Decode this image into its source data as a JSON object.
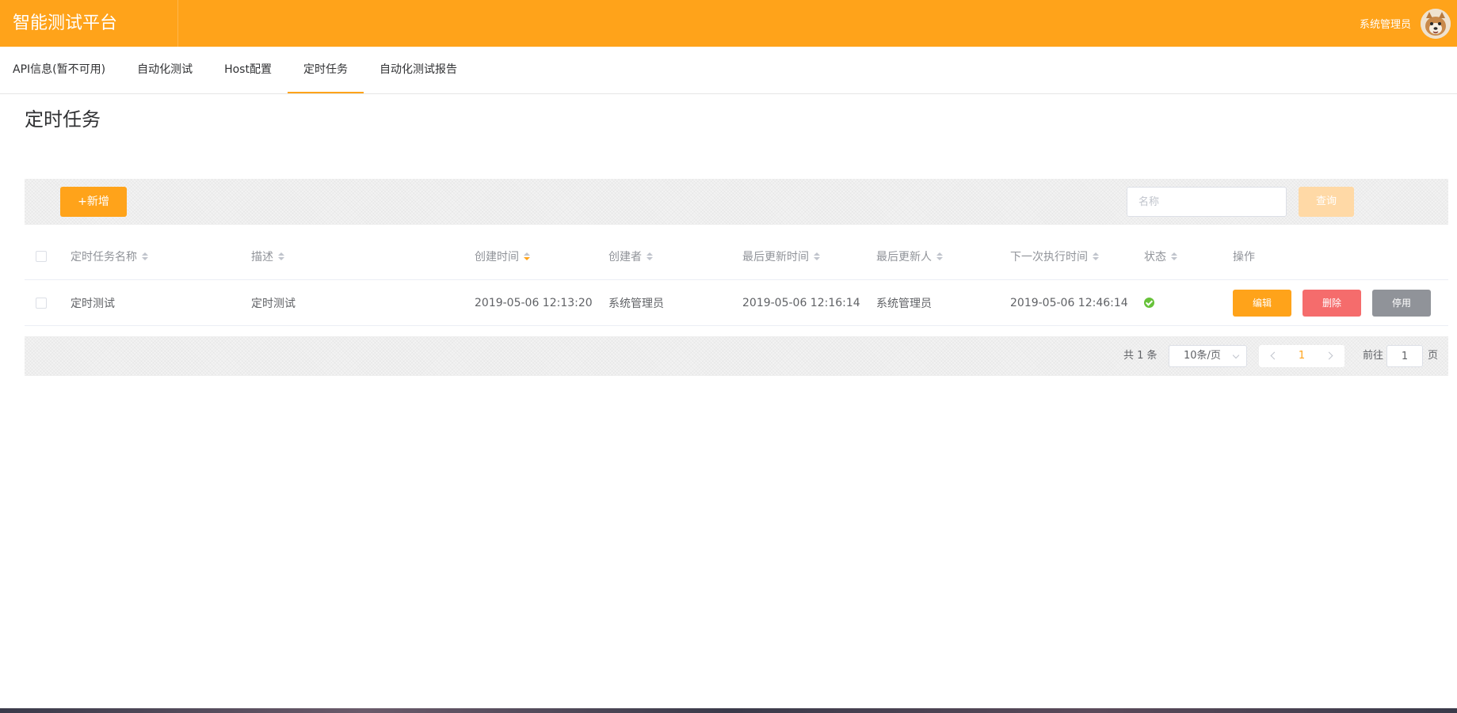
{
  "app": {
    "title": "智能测试平台",
    "user_name": "系统管理员"
  },
  "nav": {
    "items": [
      {
        "label": "API信息(暂不可用)",
        "active": false
      },
      {
        "label": "自动化测试",
        "active": false
      },
      {
        "label": "Host配置",
        "active": false
      },
      {
        "label": "定时任务",
        "active": true
      },
      {
        "label": "自动化测试报告",
        "active": false
      }
    ]
  },
  "page": {
    "title": "定时任务"
  },
  "toolbar": {
    "add_label": "+新增",
    "search_placeholder": "名称",
    "query_label": "查询"
  },
  "table": {
    "headers": [
      "定时任务名称",
      "描述",
      "创建时间",
      "创建者",
      "最后更新时间",
      "最后更新人",
      "下一次执行时间",
      "状态",
      "操作"
    ],
    "rows": [
      {
        "name": "定时测试",
        "description": "定时测试",
        "created_at": "2019-05-06 12:13:20",
        "creator": "系统管理员",
        "updated_at": "2019-05-06 12:16:14",
        "updater": "系统管理员",
        "next_run": "2019-05-06 12:46:14",
        "status": "enabled",
        "actions": {
          "edit": "编辑",
          "delete": "删除",
          "disable": "停用"
        }
      }
    ]
  },
  "pagination": {
    "total_text": "共 1 条",
    "page_size": "10条/页",
    "current_page": "1",
    "goto_label": "前往",
    "goto_value": "1",
    "page_suffix": "页"
  },
  "colors": {
    "accent": "#ffa31a",
    "danger": "#f56c6c",
    "neutral": "#909399",
    "success": "#67c23a"
  },
  "icons": {
    "status": "check-circle-icon",
    "sort": "sort-caret-icon",
    "prev": "chevron-left-icon",
    "next": "chevron-right-icon",
    "select": "chevron-down-icon"
  }
}
